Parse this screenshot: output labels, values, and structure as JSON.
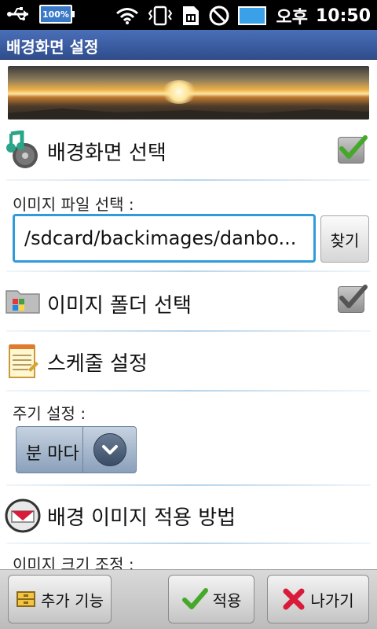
{
  "status_bar": {
    "battery_label": "100%",
    "ampm": "오후",
    "time": "10:50"
  },
  "title": "배경화면 설정",
  "wallpaper_select": {
    "label": "배경화면 선택",
    "checked": true,
    "icon": "music-note-icon"
  },
  "image_file": {
    "label": "이미지 파일 선택 :",
    "value": "/sdcard/backimages/danbo...",
    "find_label": "찾기"
  },
  "image_folder": {
    "label": "이미지 폴더 선택",
    "checked": true,
    "icon": "folder-icon"
  },
  "schedule": {
    "label": "스케줄 설정",
    "icon": "notepad-icon"
  },
  "interval": {
    "label": "주기 설정 :",
    "selected": "분 마다"
  },
  "apply_method": {
    "label": "배경 이미지 적용 방법",
    "icon": "mail-icon"
  },
  "image_resize": {
    "label": "이미지 크기 조정 :"
  },
  "bottom_bar": {
    "more_label": "추가 기능",
    "apply_label": "적용",
    "exit_label": "나가기"
  },
  "colors": {
    "title_bar": "#2f4d8e",
    "input_border": "#2f9bd8",
    "check_green": "#46a82a"
  }
}
